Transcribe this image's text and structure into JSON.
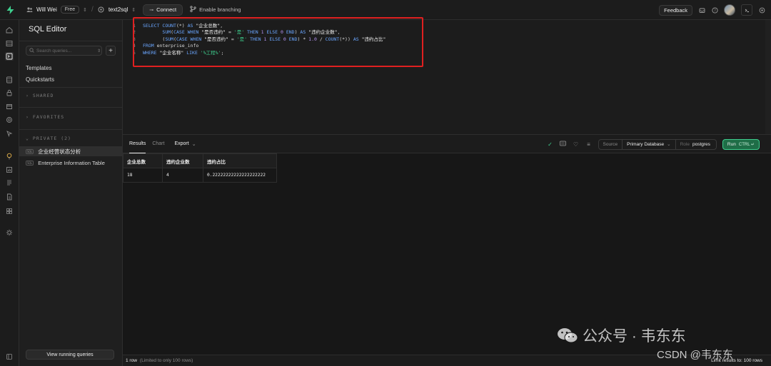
{
  "topbar": {
    "org_name": "Will Wei",
    "plan_badge": "Free",
    "project_name": "text2sql",
    "connect_label": "Connect",
    "branching_label": "Enable branching",
    "feedback_label": "Feedback"
  },
  "sidebar": {
    "title": "SQL Editor",
    "search_placeholder": "Search queries...",
    "add_label": "+",
    "templates_label": "Templates",
    "quickstarts_label": "Quickstarts",
    "shared_label": "SHARED",
    "favorites_label": "FAVORITES",
    "private_label": "PRIVATE (2)",
    "sql_tag": "SQL",
    "items": [
      {
        "label": "企业经营状态分析",
        "active": true
      },
      {
        "label": "Enterprise Information Table",
        "active": false
      }
    ],
    "view_running_label": "View running queries"
  },
  "editor": {
    "lines": [
      {
        "n": "1",
        "parts": [
          [
            "kw2",
            "SELECT "
          ],
          [
            "kw2",
            "COUNT"
          ],
          [
            "plain",
            "(*) "
          ],
          [
            "kw2",
            "AS "
          ],
          [
            "str",
            "\"企业总数\""
          ],
          [
            "plain",
            ","
          ]
        ]
      },
      {
        "n": "2",
        "parts": [
          [
            "plain",
            "       "
          ],
          [
            "kw2",
            "SUM"
          ],
          [
            "plain",
            "("
          ],
          [
            "kw2",
            "CASE WHEN "
          ],
          [
            "str",
            "\"是否违约\""
          ],
          [
            "plain",
            " = "
          ],
          [
            "lit",
            "'是'"
          ],
          [
            "kw2",
            " THEN "
          ],
          [
            "num",
            "1"
          ],
          [
            "kw2",
            " ELSE "
          ],
          [
            "num",
            "0"
          ],
          [
            "kw2",
            " END"
          ],
          [
            "plain",
            ") "
          ],
          [
            "kw2",
            "AS "
          ],
          [
            "str",
            "\"违约企业数\""
          ],
          [
            "plain",
            ","
          ]
        ]
      },
      {
        "n": "3",
        "parts": [
          [
            "plain",
            "       ("
          ],
          [
            "kw2",
            "SUM"
          ],
          [
            "plain",
            "("
          ],
          [
            "kw2",
            "CASE WHEN "
          ],
          [
            "str",
            "\"是否违约\""
          ],
          [
            "plain",
            " = "
          ],
          [
            "lit",
            "'是'"
          ],
          [
            "kw2",
            " THEN "
          ],
          [
            "num",
            "1"
          ],
          [
            "kw2",
            " ELSE "
          ],
          [
            "num",
            "0"
          ],
          [
            "kw2",
            " END"
          ],
          [
            "plain",
            ") * "
          ],
          [
            "num",
            "1.0"
          ],
          [
            "plain",
            " / "
          ],
          [
            "kw2",
            "COUNT"
          ],
          [
            "plain",
            "(*)) "
          ],
          [
            "kw2",
            "AS "
          ],
          [
            "str",
            "\"违约占比\""
          ]
        ]
      },
      {
        "n": "4",
        "parts": [
          [
            "kw2",
            "FROM "
          ],
          [
            "plain",
            "enterprise_info"
          ]
        ]
      },
      {
        "n": "5",
        "parts": [
          [
            "kw2",
            "WHERE "
          ],
          [
            "str",
            "\"企业名称\""
          ],
          [
            "kw2",
            " LIKE "
          ],
          [
            "lit",
            "'%工程%'"
          ],
          [
            "plain",
            ";"
          ]
        ]
      }
    ]
  },
  "results": {
    "tabs": [
      {
        "label": "Results",
        "active": true
      },
      {
        "label": "Chart",
        "active": false
      }
    ],
    "export_label": "Export",
    "source_label": "Source",
    "source_value": "Primary Database",
    "role_label": "Role",
    "role_value": "postgres",
    "run_label": "Run",
    "run_shortcut": "CTRL ↵",
    "columns": [
      "企业总数",
      "违约企业数",
      "违约占比"
    ],
    "rows": [
      [
        "18",
        "4",
        "0.22222222222222222222"
      ]
    ],
    "row_count": "1 row",
    "row_limit_note": "(Limited to only 100 rows)",
    "limit_right": "Limit results to: 100 rows"
  },
  "watermark": {
    "line1": "公众号 · 韦东东",
    "line2": "CSDN @韦东东"
  }
}
